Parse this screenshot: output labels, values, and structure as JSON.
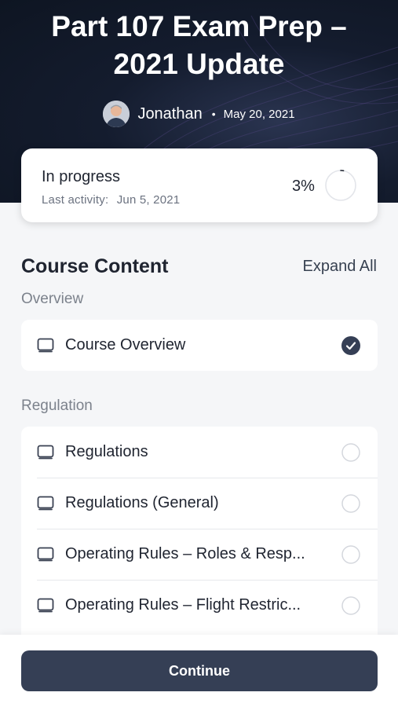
{
  "course": {
    "title": "Part 107 Exam Prep – 2021 Update",
    "author": "Jonathan",
    "separator": "•",
    "date": "May 20, 2021"
  },
  "progress": {
    "status": "In progress",
    "last_activity_label": "Last activity:",
    "last_activity_date": "Jun 5, 2021",
    "percent_text": "3%",
    "percent_value": 3
  },
  "content": {
    "heading": "Course Content",
    "expand_label": "Expand All",
    "sections": [
      {
        "label": "Overview",
        "items": [
          {
            "label": "Course Overview",
            "icon": "book-icon",
            "completed": true
          }
        ]
      },
      {
        "label": "Regulation",
        "items": [
          {
            "label": "Regulations",
            "icon": "book-icon",
            "completed": false
          },
          {
            "label": "Regulations (General)",
            "icon": "book-icon",
            "completed": false
          },
          {
            "label": "Operating Rules – Roles & Resp...",
            "icon": "book-icon",
            "completed": false
          },
          {
            "label": "Operating Rules – Flight Restric...",
            "icon": "book-icon",
            "completed": false
          }
        ]
      }
    ]
  },
  "footer": {
    "continue_label": "Continue"
  },
  "colors": {
    "primary": "#353f55",
    "check": "#353f55",
    "hero_bg": "#141c2e"
  }
}
